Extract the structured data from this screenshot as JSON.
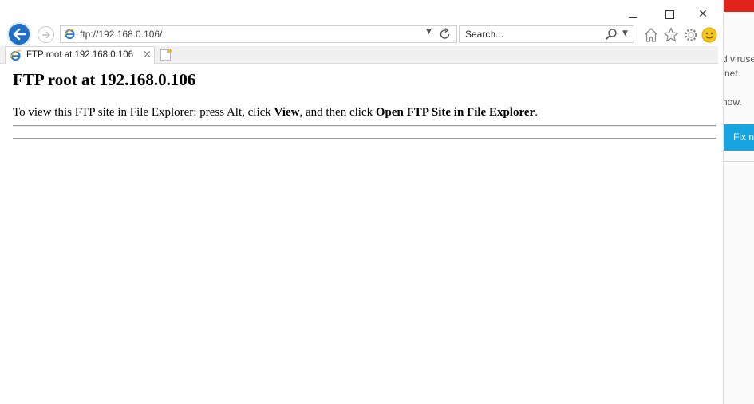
{
  "browser": {
    "address": "ftp://192.168.0.106/",
    "search_placeholder": "Search...",
    "tab_title": "FTP root at 192.168.0.106",
    "tab_close": "×"
  },
  "window_controls": {
    "close": "✕"
  },
  "page": {
    "heading": "FTP root at 192.168.0.106",
    "instruction_part1": "To view this FTP site in File Explorer: press Alt, click ",
    "instruction_bold1": "View",
    "instruction_part2": ", and then click ",
    "instruction_bold2": "Open FTP Site in File Explorer",
    "instruction_part3": "."
  },
  "background_window": {
    "line1": "d viruse",
    "line2": "rnet.",
    "line3": "now.",
    "button_label": "Fix n"
  },
  "colors": {
    "back_button": "#1f6fc4",
    "ie_logo": "#2b7fd0",
    "feedback_smiley": "#f5c518",
    "bg_accent_red": "#e2231a",
    "bg_button_blue": "#16a5e0"
  },
  "icons": {
    "back": "back-arrow-icon",
    "forward": "forward-arrow-icon",
    "ie_logo": "ie-logo-icon",
    "refresh": "refresh-icon",
    "search": "search-icon",
    "home": "home-icon",
    "favorites": "star-icon",
    "settings": "gear-icon",
    "feedback": "smiley-icon",
    "new_tab": "new-tab-icon"
  }
}
